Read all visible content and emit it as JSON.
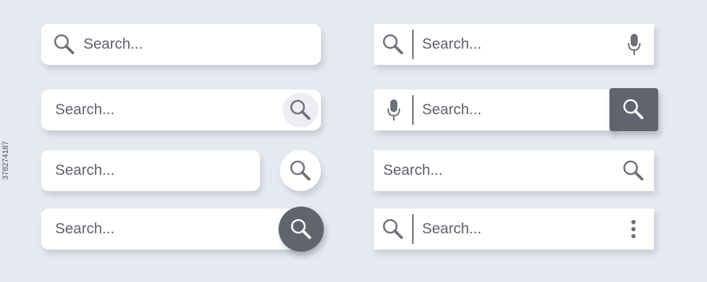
{
  "bars": [
    {
      "placeholder": "Search...",
      "icon": "search-icon"
    },
    {
      "placeholder": "Search...",
      "icon": "search-icon"
    },
    {
      "placeholder": "Search...",
      "icon": "search-icon"
    },
    {
      "placeholder": "Search...",
      "icon": "search-icon"
    },
    {
      "placeholder": "Search...",
      "icon": "search-icon",
      "trailing_icon": "microphone-icon"
    },
    {
      "placeholder": "Search...",
      "icon": "microphone-icon",
      "trailing_icon": "search-icon"
    },
    {
      "placeholder": "Search...",
      "icon": "search-icon"
    },
    {
      "placeholder": "Search...",
      "icon": "search-icon",
      "trailing_icon": "more-vertical-icon"
    }
  ],
  "stock_id": "378274187",
  "colors": {
    "background": "#e7e9f0",
    "bar": "#ffffff",
    "text": "#5d6068",
    "icon": "#6e7079",
    "dark_button": "#5f646e",
    "light_button": "#eceef3"
  }
}
